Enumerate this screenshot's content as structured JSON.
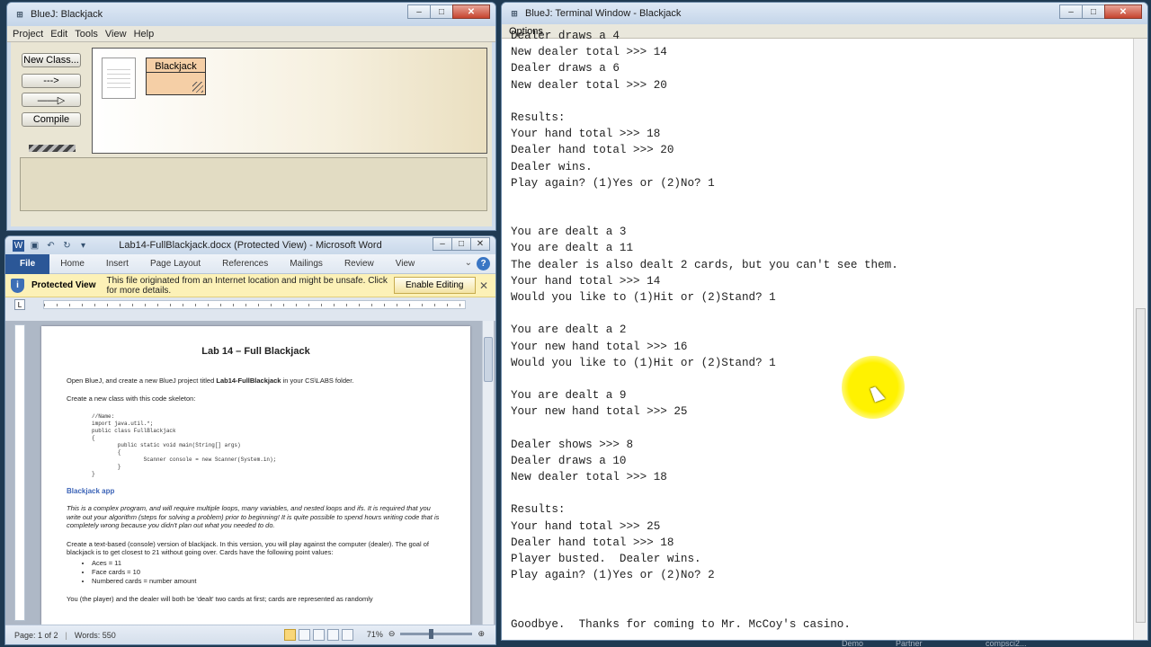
{
  "bluej": {
    "title": "BlueJ:  Blackjack",
    "menu": [
      "Project",
      "Edit",
      "Tools",
      "View",
      "Help"
    ],
    "buttons": {
      "new_class": "New Class...",
      "dashed_arrow": "--->",
      "solid_arrow": "——▷",
      "compile": "Compile"
    },
    "class_name": "Blackjack"
  },
  "word": {
    "title": "Lab14-FullBlackjack.docx (Protected View)  -  Microsoft Word",
    "tabs": [
      "File",
      "Home",
      "Insert",
      "Page Layout",
      "References",
      "Mailings",
      "Review",
      "View"
    ],
    "protected": {
      "label": "Protected View",
      "message": "This file originated from an Internet location and might be unsafe. Click for more details.",
      "button": "Enable Editing"
    },
    "doc": {
      "title": "Lab 14 – Full Blackjack",
      "intro_a": "Open BlueJ, and create a new BlueJ project titled ",
      "intro_bold": "Lab14-FullBlackjack",
      "intro_b": " in your CS\\LABS folder.",
      "create_class": "Create a new class with this code skeleton:",
      "code": [
        "//Name:",
        "import java.util.*;",
        "",
        "public class FullBlackjack",
        "{",
        "        public static void main(String[] args)",
        "        {",
        "                Scanner console = new Scanner(System.in);",
        "        }",
        "}"
      ],
      "heading": "Blackjack app",
      "italic_para": "This is a complex program, and will require multiple loops, many variables, and nested loops and ifs.  It is required that you write out your algorithm (steps for solving a problem) prior to beginning!  It is quite possible to spend hours writing code that is completely wrong because you didn't plan out what you needed to do.",
      "para2": "Create a text-based (console) version of blackjack.  In this version, you will play against the computer (dealer).  The goal of blackjack is to get closest to 21 without going over.  Cards have the following point values:",
      "bullets": [
        "Aces = 11",
        "Face cards = 10",
        "Numbered cards = number amount"
      ],
      "para3": "You (the player) and the dealer will both be 'dealt' two cards at first; cards are represented as randomly"
    },
    "status": {
      "page": "Page: 1 of 2",
      "words": "Words: 550",
      "zoom": "71%"
    }
  },
  "terminal": {
    "title": "BlueJ: Terminal Window - Blackjack",
    "menu_options": "Options",
    "lines": [
      "Dealer draws a 4",
      "New dealer total >>> 14",
      "Dealer draws a 6",
      "New dealer total >>> 20",
      "",
      "Results:",
      "Your hand total >>> 18",
      "Dealer hand total >>> 20",
      "Dealer wins.",
      "Play again? (1)Yes or (2)No? 1",
      "",
      "",
      "You are dealt a 3",
      "You are dealt a 11",
      "The dealer is also dealt 2 cards, but you can't see them.",
      "Your hand total >>> 14",
      "Would you like to (1)Hit or (2)Stand? 1",
      "",
      "You are dealt a 2",
      "Your new hand total >>> 16",
      "Would you like to (1)Hit or (2)Stand? 1",
      "",
      "You are dealt a 9",
      "Your new hand total >>> 25",
      "",
      "Dealer shows >>> 8",
      "Dealer draws a 10",
      "New dealer total >>> 18",
      "",
      "Results:",
      "Your hand total >>> 25",
      "Dealer hand total >>> 18",
      "Player busted.  Dealer wins.",
      "Play again? (1)Yes or (2)No? 2",
      "",
      "",
      "Goodbye.  Thanks for coming to Mr. McCoy's casino."
    ]
  },
  "taskbar_hints": [
    "Demo",
    "Partner",
    "compsci2..."
  ]
}
